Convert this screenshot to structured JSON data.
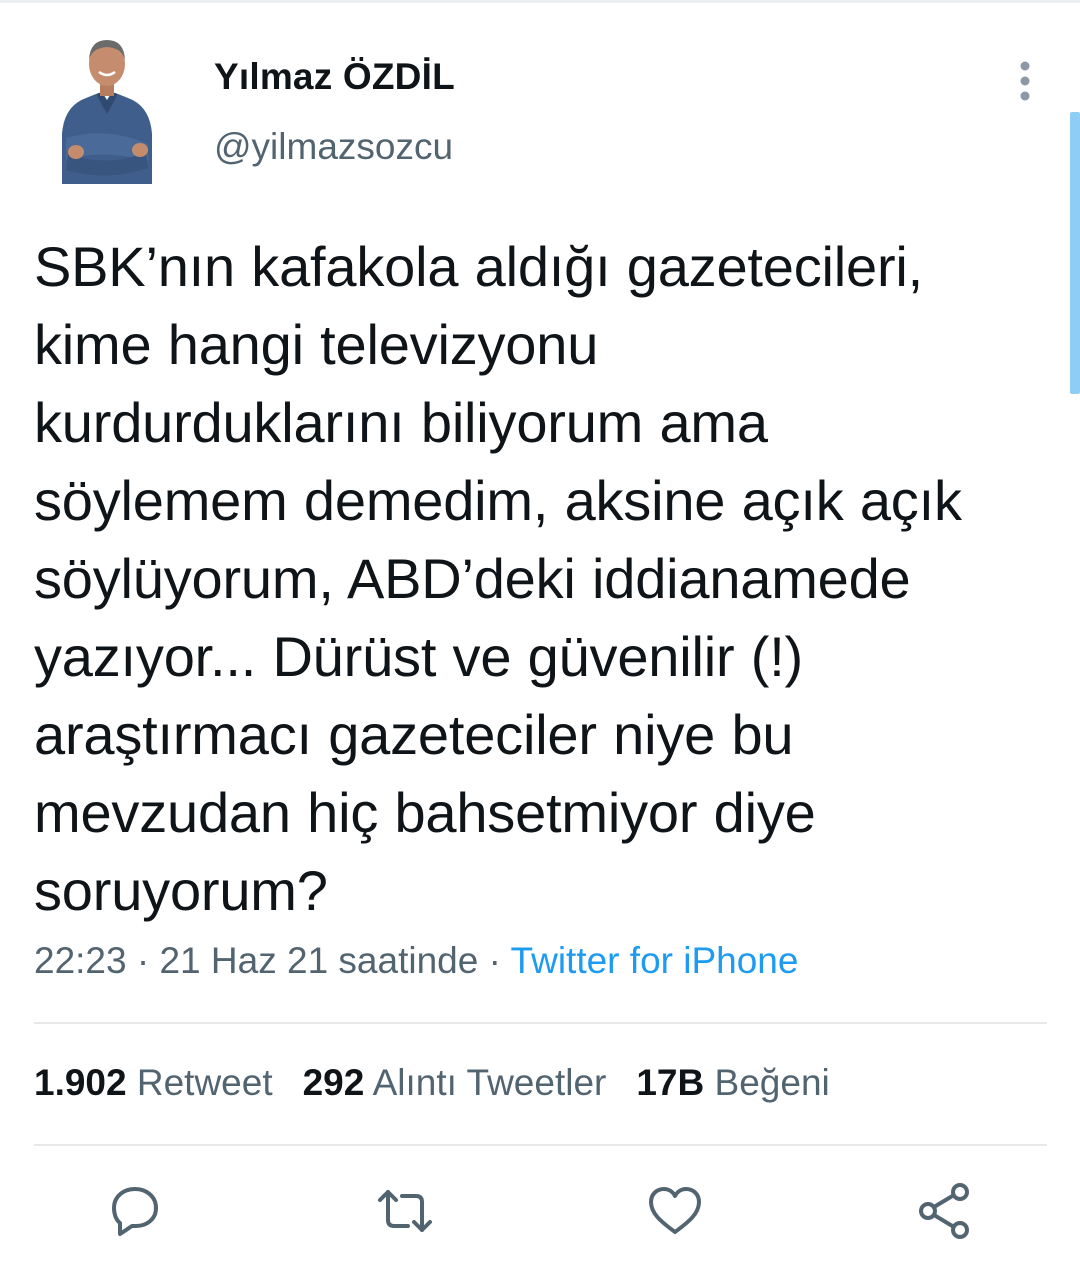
{
  "author": {
    "display_name": "Yılmaz ÖZDİL",
    "handle": "@yilmazsozcu"
  },
  "tweet": {
    "lines": [
      "SBK’nın kafakola aldığı gazetecileri,",
      "kime hangi televizyonu",
      "kurdurduklarını biliyorum ama",
      "söylemem demedim, aksine açık açık",
      "söylüyorum, ABD’deki iddianamede",
      "yazıyor... Dürüst ve güvenilir (!)",
      "araştırmacı gazeteciler niye bu",
      "mevzudan hiç bahsetmiyor diye",
      "soruyorum?"
    ]
  },
  "meta": {
    "time": "22:23",
    "date": "21 Haz 21 saatinde",
    "separator": " · ",
    "source": "Twitter for iPhone"
  },
  "stats": {
    "retweets": {
      "count": "1.902",
      "label": "Retweet"
    },
    "quotes": {
      "count": "292",
      "label": "Alıntı Tweetler"
    },
    "likes": {
      "count": "17B",
      "label": "Beğeni"
    }
  },
  "actions": {
    "reply_icon": "reply-icon",
    "retweet_icon": "retweet-icon",
    "like_icon": "heart-icon",
    "share_icon": "share-icon"
  },
  "colors": {
    "text": "#0f1419",
    "muted": "#536471",
    "accent": "#1d9bf0",
    "scrollbar": "#8ecdf5"
  }
}
